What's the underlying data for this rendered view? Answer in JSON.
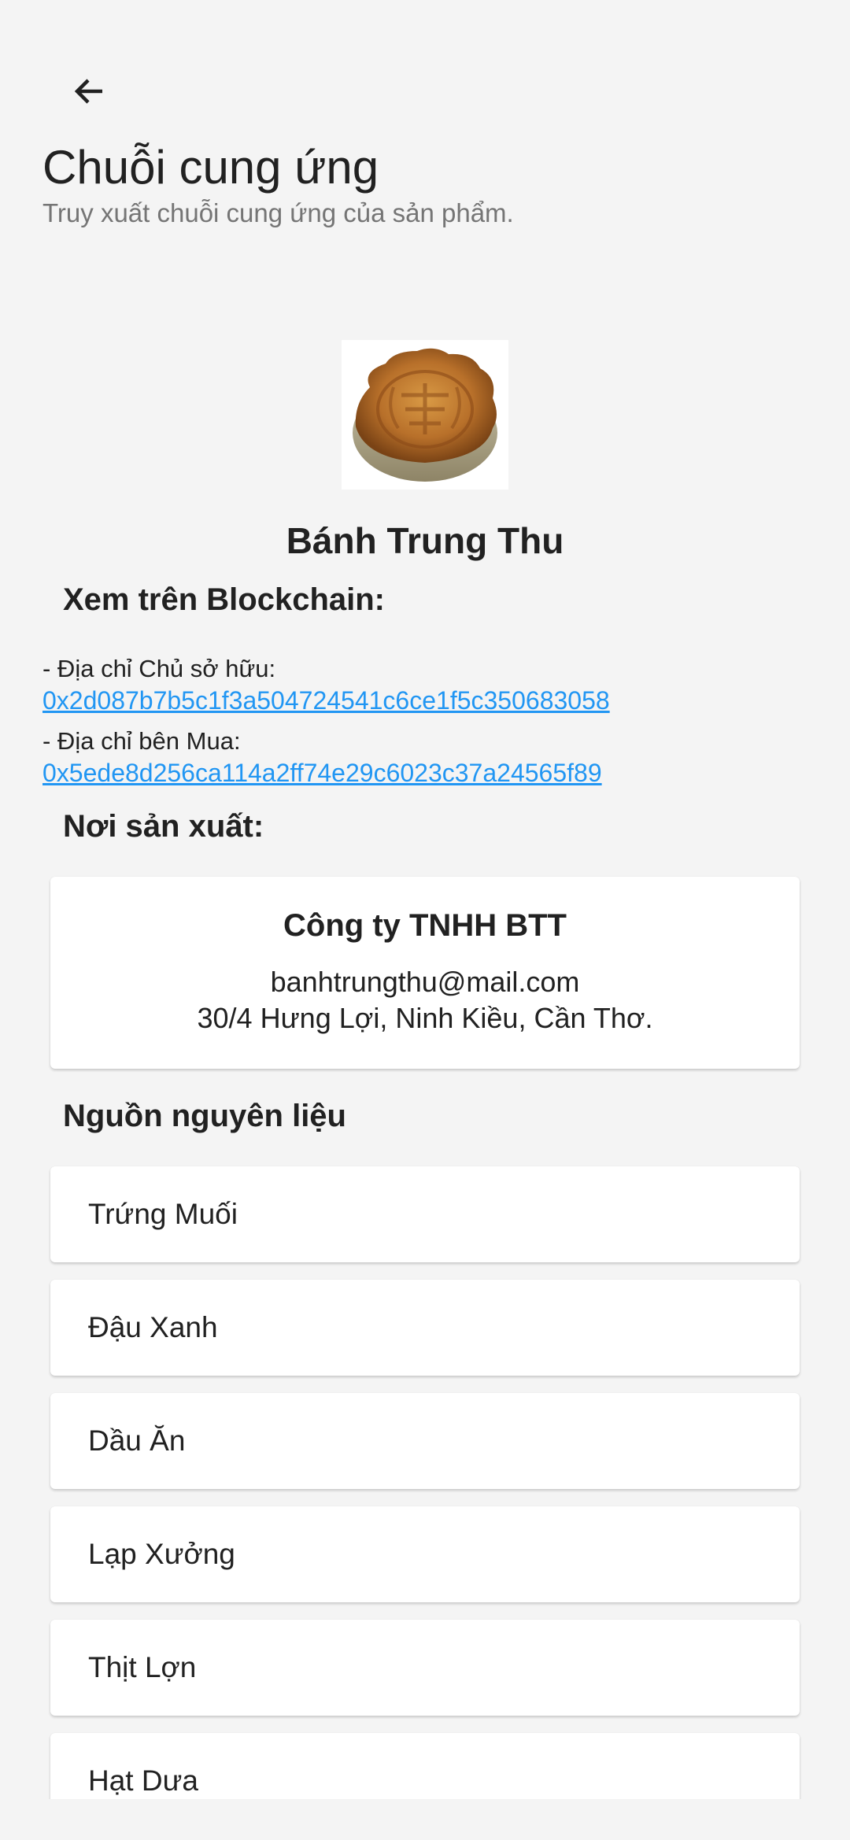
{
  "header": {
    "title": "Chuỗi cung ứng",
    "subtitle": "Truy xuất chuỗi cung ứng của sản phẩm."
  },
  "product": {
    "name": "Bánh Trung Thu",
    "image": "mooncake-image"
  },
  "blockchain": {
    "title": "Xem trên Blockchain:",
    "owner_label": "- Địa chỉ Chủ sở hữu:",
    "owner_address": "0x2d087b7b5c1f3a504724541c6ce1f5c350683058",
    "buyer_label": "- Địa chỉ bên Mua:",
    "buyer_address": "0x5ede8d256ca114a2ff74e29c6023c37a24565f89"
  },
  "producer": {
    "title": "Nơi sản xuất:",
    "name": "Công ty TNHH BTT",
    "email": "banhtrungthu@mail.com",
    "address": "30/4 Hưng Lợi, Ninh Kiều, Cần Thơ."
  },
  "ingredients": {
    "title": "Nguồn nguyên liệu",
    "items": [
      "Trứng Muối",
      "Đậu Xanh",
      "Dầu Ăn",
      "Lạp Xưởng",
      "Thịt Lợn",
      "Hạt Dưa"
    ]
  },
  "colors": {
    "background": "#f4f4f4",
    "link": "#2196f3",
    "text": "#212121",
    "subtitle": "#757575"
  },
  "icons": {
    "back": "arrow-left-icon"
  }
}
